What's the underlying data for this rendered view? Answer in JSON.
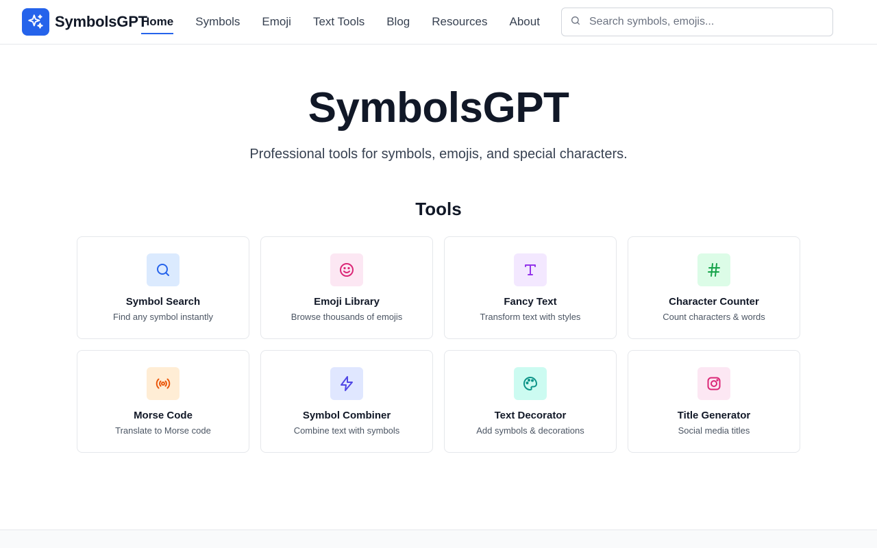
{
  "header": {
    "brand": "SymbolsGPT",
    "nav": [
      {
        "label": "Home",
        "active": true
      },
      {
        "label": "Symbols"
      },
      {
        "label": "Emoji"
      },
      {
        "label": "Text Tools"
      },
      {
        "label": "Blog"
      },
      {
        "label": "Resources"
      },
      {
        "label": "About"
      }
    ],
    "search": {
      "placeholder": "Search symbols, emojis...",
      "value": ""
    }
  },
  "hero": {
    "title": "SymbolsGPT",
    "subtitle": "Professional tools for symbols, emojis, and special characters."
  },
  "tools": {
    "heading": "Tools",
    "items": [
      {
        "title": "Symbol Search",
        "desc": "Find any symbol instantly",
        "icon": "search-icon",
        "bg": "#dbeafe",
        "fg": "#2563eb"
      },
      {
        "title": "Emoji Library",
        "desc": "Browse thousands of emojis",
        "icon": "smile-icon",
        "bg": "#fce7f3",
        "fg": "#db2777"
      },
      {
        "title": "Fancy Text",
        "desc": "Transform text with styles",
        "icon": "type-icon",
        "bg": "#f3e8ff",
        "fg": "#9333ea"
      },
      {
        "title": "Character Counter",
        "desc": "Count characters & words",
        "icon": "hash-icon",
        "bg": "#dcfce7",
        "fg": "#16a34a"
      },
      {
        "title": "Morse Code",
        "desc": "Translate to Morse code",
        "icon": "radio-icon",
        "bg": "#ffedd5",
        "fg": "#ea580c"
      },
      {
        "title": "Symbol Combiner",
        "desc": "Combine text with symbols",
        "icon": "zap-icon",
        "bg": "#e0e7ff",
        "fg": "#4f46e5"
      },
      {
        "title": "Text Decorator",
        "desc": "Add symbols & decorations",
        "icon": "palette-icon",
        "bg": "#ccfbf1",
        "fg": "#0d9488"
      },
      {
        "title": "Title Generator",
        "desc": "Social media titles",
        "icon": "instagram-icon",
        "bg": "#fce7f3",
        "fg": "#db2777"
      }
    ]
  },
  "colors": {
    "accent": "#2563eb"
  }
}
